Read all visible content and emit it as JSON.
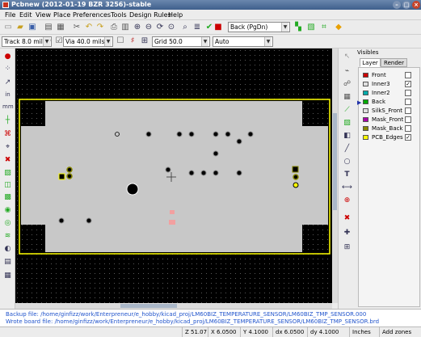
{
  "window": {
    "title": "Pcbnew (2012-01-19 BZR 3256)-stable"
  },
  "menu": [
    {
      "label": "File"
    },
    {
      "label": "Edit"
    },
    {
      "label": "View"
    },
    {
      "label": "Place"
    },
    {
      "label": "Preferences"
    },
    {
      "label": "Tools"
    },
    {
      "label": "Design Rules"
    },
    {
      "label": "Help"
    }
  ],
  "toolbar": {
    "layer_select": "Back (PgDn)",
    "track_select": "Track 8.0 mils *",
    "via_select": "Via 40.0 mils *",
    "grid_select": "Grid 50.0",
    "zoom_select": "Auto"
  },
  "layers_panel": {
    "title": "Visibles",
    "tabs": [
      {
        "label": "Layer"
      },
      {
        "label": "Render"
      }
    ],
    "layers": [
      {
        "name": "Front",
        "color": "#cc0000",
        "checked": ""
      },
      {
        "name": "Inner3",
        "color": "#e0e0e0",
        "checked": "✓"
      },
      {
        "name": "Inner2",
        "color": "#00aaaa",
        "checked": ""
      },
      {
        "name": "Back",
        "color": "#00aa00",
        "checked": ""
      },
      {
        "name": "SilkS_Front",
        "color": "#e0e0e0",
        "checked": ""
      },
      {
        "name": "Mask_Front",
        "color": "#aa00aa",
        "checked": ""
      },
      {
        "name": "Mask_Back",
        "color": "#888800",
        "checked": ""
      },
      {
        "name": "PCB_Edges",
        "color": "#ffff00",
        "checked": "✓"
      }
    ]
  },
  "messages": {
    "backup": "Backup file: /home/ginfizz/work/Enterpreneur/e_hobby/kicad_proj/LM60BIZ_TEMPERATURE_SENSOR/LM60BIZ_TMP_SENSOR.000",
    "wrote": "Wrote board file: /home/ginfizz/work/Enterpreneur/e_hobby/kicad_proj/LM60BIZ_TEMPERATURE_SENSOR/LM60BIZ_TMP_SENSOR.brd"
  },
  "status": {
    "zoom": "Z 51.07",
    "x": "X 6.0500",
    "y": "Y 4.1000",
    "dx": "dx 6.0500",
    "dy": "dy 4.1000",
    "units": "Inches",
    "mode": "Add zones"
  },
  "colors": {
    "board_edge": "#ffff00",
    "board_fill": "#c8c8c8",
    "message_text": "#2255cc"
  }
}
